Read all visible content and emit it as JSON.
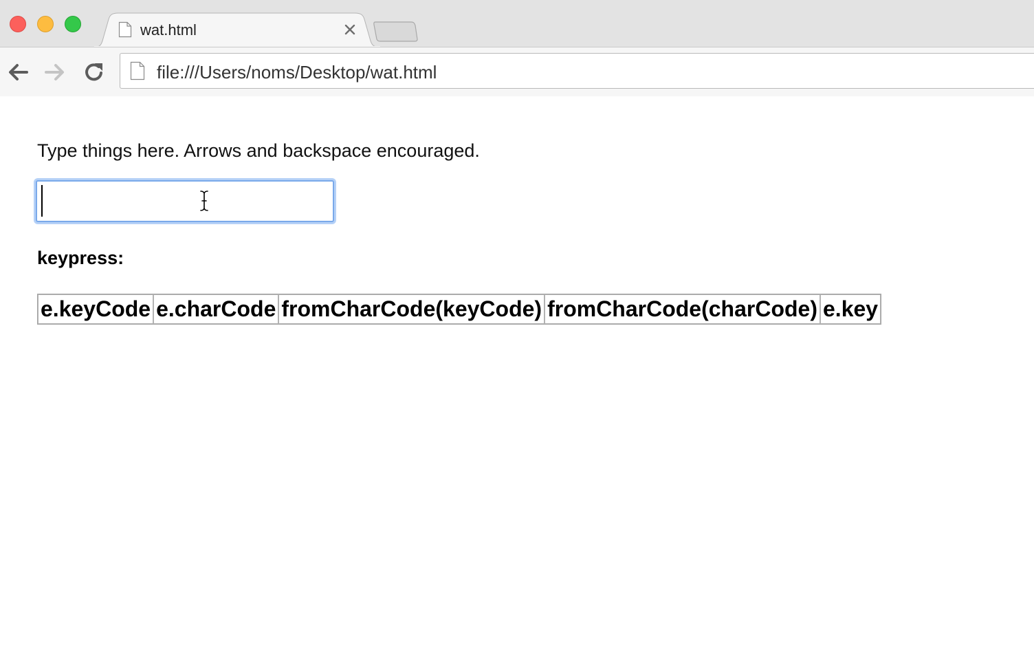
{
  "window": {
    "controls": [
      "close",
      "minimize",
      "zoom"
    ]
  },
  "tab": {
    "title": "wat.html",
    "icon": "page-icon",
    "close_icon": "close-icon"
  },
  "toolbar": {
    "back_icon": "back-arrow-icon",
    "forward_icon": "forward-arrow-icon",
    "reload_icon": "reload-icon",
    "url": "file:///Users/noms/Desktop/wat.html"
  },
  "page": {
    "instructions": "Type things here. Arrows and backspace encouraged.",
    "input": {
      "value": "",
      "placeholder": ""
    },
    "event_heading": "keypress:",
    "table": {
      "headers": [
        "e.keyCode",
        "e.charCode",
        "fromCharCode(keyCode)",
        "fromCharCode(charCode)",
        "e.key"
      ]
    }
  }
}
